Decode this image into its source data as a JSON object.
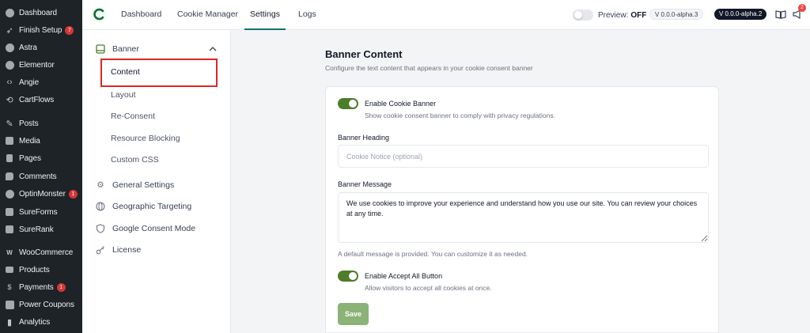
{
  "wp_sidebar": {
    "items": [
      {
        "label": "Dashboard",
        "icon": "dashboard-icon"
      },
      {
        "label": "Finish Setup",
        "icon": "rocket-icon",
        "badge": "7"
      },
      {
        "label": "Astra",
        "icon": "astra-icon"
      },
      {
        "label": "Elementor",
        "icon": "elementor-icon"
      },
      {
        "label": "Angie",
        "icon": "angie-icon"
      },
      {
        "label": "CartFlows",
        "icon": "cartflows-icon"
      },
      {
        "label": "Posts",
        "icon": "pin-icon"
      },
      {
        "label": "Media",
        "icon": "media-icon"
      },
      {
        "label": "Pages",
        "icon": "pages-icon"
      },
      {
        "label": "Comments",
        "icon": "comments-icon"
      },
      {
        "label": "OptinMonster",
        "icon": "optinmonster-icon",
        "badge": "1"
      },
      {
        "label": "SureForms",
        "icon": "sureforms-icon"
      },
      {
        "label": "SureRank",
        "icon": "surerank-icon"
      },
      {
        "label": "WooCommerce",
        "icon": "woo-icon"
      },
      {
        "label": "Products",
        "icon": "products-icon"
      },
      {
        "label": "Payments",
        "icon": "payments-icon",
        "badge": "1"
      },
      {
        "label": "Power Coupons",
        "icon": "coupons-icon"
      },
      {
        "label": "Analytics",
        "icon": "analytics-icon"
      }
    ]
  },
  "topbar": {
    "tabs": [
      "Dashboard",
      "Cookie Manager",
      "Settings",
      "Logs"
    ],
    "active_tab": "Settings",
    "preview_label": "Preview:",
    "preview_state": "OFF",
    "version_1": "V 0.0.0-alpha.3",
    "version_2": "V 0.0.0-alpha.2",
    "notification_count": "2"
  },
  "settings_nav": {
    "banner_label": "Banner",
    "banner_subitems": [
      "Content",
      "Layout",
      "Re-Consent",
      "Resource Blocking",
      "Custom CSS"
    ],
    "items": [
      {
        "label": "General Settings",
        "icon": "gear-icon"
      },
      {
        "label": "Geographic Targeting",
        "icon": "globe-icon"
      },
      {
        "label": "Google Consent Mode",
        "icon": "shield-icon"
      },
      {
        "label": "License",
        "icon": "key-icon"
      }
    ]
  },
  "main": {
    "title": "Banner Content",
    "description": "Configure the text content that appears in your cookie consent banner",
    "enable_banner_label": "Enable Cookie Banner",
    "enable_banner_help": "Show cookie consent banner to comply with privacy regulations.",
    "heading_label": "Banner Heading",
    "heading_placeholder": "Cookie Notice (optional)",
    "message_label": "Banner Message",
    "message_value": "We use cookies to improve your experience and understand how you use our site. You can review your choices at any time.",
    "message_help": "A default message is provided. You can customize it as needed.",
    "accept_all_label": "Enable Accept All Button",
    "accept_all_help": "Allow visitors to accept all cookies at once.",
    "save_label": "Save"
  },
  "colors": {
    "accent_green": "#4d7c2a",
    "save_button": "#8bb377",
    "highlight_red": "#dc2626",
    "wp_sidebar_bg": "#1d2327"
  }
}
